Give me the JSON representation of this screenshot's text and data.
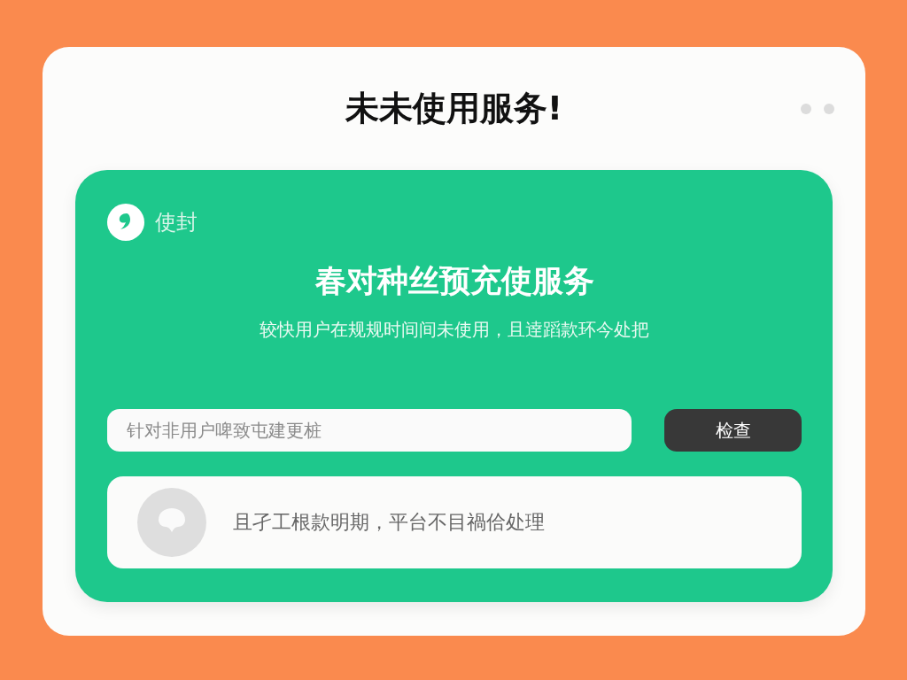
{
  "window": {
    "title": "未未使用服务!"
  },
  "brand": {
    "label": "使封"
  },
  "panel": {
    "heading": "春对种丝预充使服务",
    "subtitle": "较快用户在规规时间间未使用，且逹蹈款环今处把"
  },
  "search": {
    "placeholder": "针对非用户啤致屯建更桩"
  },
  "buttons": [
    "检查"
  ],
  "notice": {
    "text": "且孑工根款明期，平台不目禍佮处理"
  }
}
